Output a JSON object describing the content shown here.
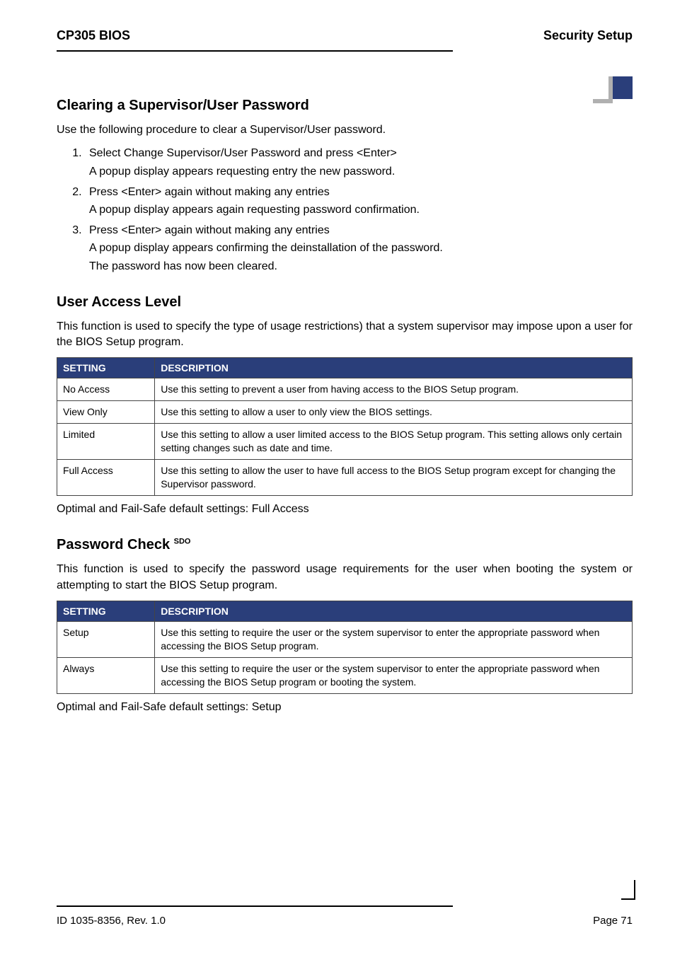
{
  "header": {
    "left": "CP305 BIOS",
    "right": "Security Setup"
  },
  "section1": {
    "title": "Clearing a Supervisor/User Password",
    "intro": "Use the following procedure to clear a Supervisor/User password.",
    "steps": [
      {
        "line1": "Select Change Supervisor/User Password and press <Enter>",
        "line2": "A popup display appears requesting entry the new password."
      },
      {
        "line1": "Press <Enter> again without making any entries",
        "line2": "A popup display appears again requesting password confirmation."
      },
      {
        "line1": "Press <Enter> again without making any entries",
        "line2": "A popup display appears confirming the deinstallation of the password.",
        "line3": "The password has now been cleared."
      }
    ]
  },
  "section2": {
    "title": "User Access Level",
    "intro": "This function is used to specify the type of usage restrictions) that a system supervisor may impose upon a user for the BIOS Setup program.",
    "headers": {
      "col1": "SETTING",
      "col2": "DESCRIPTION"
    },
    "rows": [
      {
        "setting": "No Access",
        "desc": "Use this setting to prevent a user from having access to the BIOS Setup program."
      },
      {
        "setting": "View Only",
        "desc": "Use this setting to allow a user to only view the BIOS settings."
      },
      {
        "setting": "Limited",
        "desc": "Use this setting to allow a user limited access to the BIOS Setup program. This setting allows only certain setting changes such as date and time."
      },
      {
        "setting": "Full Access",
        "desc": "Use this setting to allow the user to have full access to the BIOS Setup program except for changing the Supervisor password."
      }
    ],
    "note": "Optimal and Fail-Safe default settings: Full Access"
  },
  "section3": {
    "title": "Password Check",
    "title_sup": "SDO",
    "intro": "This function is used to specify the password usage requirements for the user when booting the system or attempting to start the BIOS Setup program.",
    "headers": {
      "col1": "SETTING",
      "col2": "DESCRIPTION"
    },
    "rows": [
      {
        "setting": "Setup",
        "desc": "Use this setting to require the user or the system supervisor to enter the appropriate password when accessing the BIOS Setup program."
      },
      {
        "setting": "Always",
        "desc": "Use this setting to require the user or the system supervisor to enter the appropriate password when accessing the BIOS Setup program or booting the system."
      }
    ],
    "note": "Optimal and Fail-Safe default settings: Setup"
  },
  "footer": {
    "left": "ID 1035-8356, Rev. 1.0",
    "right": "Page 71"
  }
}
